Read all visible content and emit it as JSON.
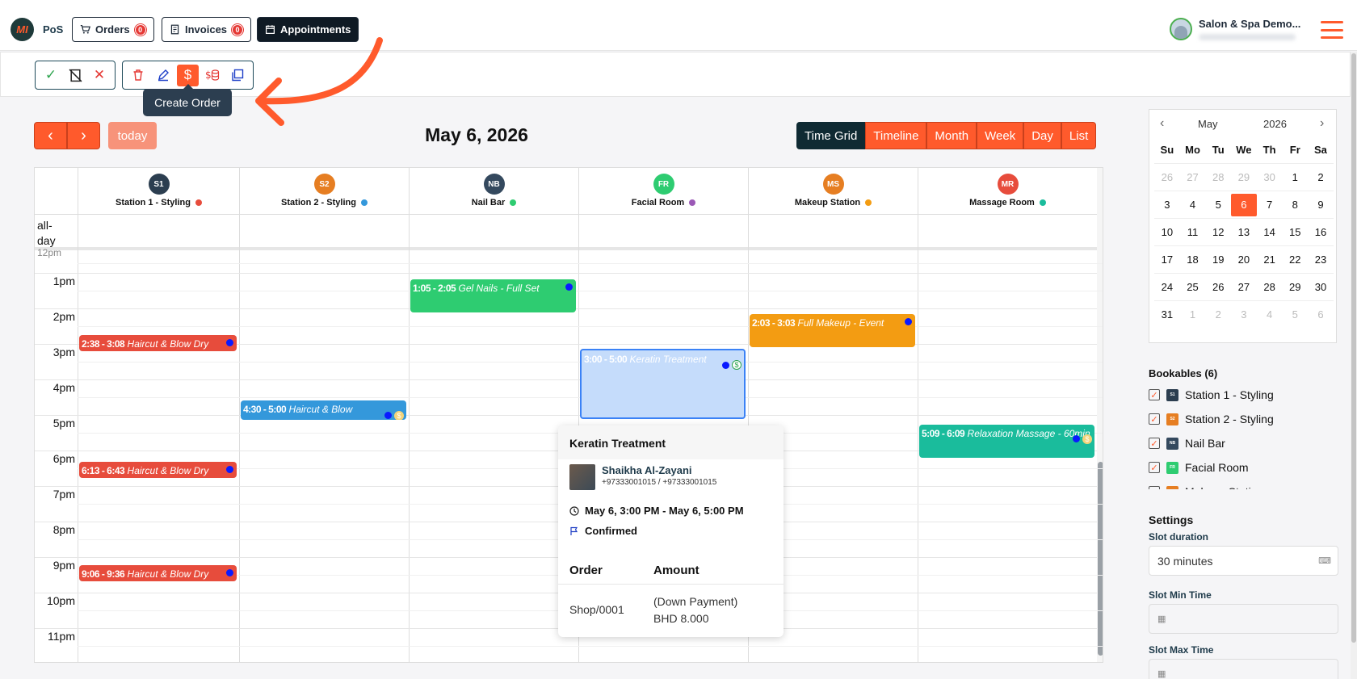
{
  "header": {
    "logo_text": "MI",
    "app_name": "PoS",
    "orders_label": "Orders",
    "orders_count": "0",
    "invoices_label": "Invoices",
    "invoices_count": "0",
    "appointments_label": "Appointments",
    "user_name": "Salon & Spa Demo..."
  },
  "toolbar": {
    "tooltip": "Create Order",
    "highlight_color": "#ff5a2c"
  },
  "calendar": {
    "today_label": "today",
    "title": "May 6, 2026",
    "views": [
      "Time Grid",
      "Timeline",
      "Month",
      "Week",
      "Day",
      "List"
    ],
    "allday_label": "all-day",
    "partial_label": "12pm",
    "hours": [
      "1pm",
      "2pm",
      "3pm",
      "4pm",
      "5pm",
      "6pm",
      "7pm",
      "8pm",
      "9pm",
      "10pm",
      "11pm"
    ],
    "resources": [
      {
        "code": "S1",
        "name": "Station 1 - Styling",
        "badge_color": "#2c3e50",
        "dot_color": "#e74c3c"
      },
      {
        "code": "S2",
        "name": "Station 2 - Styling",
        "badge_color": "#e67e22",
        "dot_color": "#3498db"
      },
      {
        "code": "NB",
        "name": "Nail Bar",
        "badge_color": "#34495e",
        "dot_color": "#2ecc71"
      },
      {
        "code": "FR",
        "name": "Facial Room",
        "badge_color": "#2ecc71",
        "dot_color": "#9b59b6"
      },
      {
        "code": "MS",
        "name": "Makeup Station",
        "badge_color": "#e67e22",
        "dot_color": "#f39c12"
      },
      {
        "code": "MR",
        "name": "Massage Room",
        "badge_color": "#e74c3c",
        "dot_color": "#1abc9c"
      }
    ],
    "events": [
      {
        "time": "1:05 - 2:05",
        "title": "Gel Nails - Full Set",
        "color": "#2ecc71"
      },
      {
        "time": "2:03 - 3:03",
        "title": "Full Makeup - Event",
        "color": "#f39c12"
      },
      {
        "time": "2:38 - 3:08",
        "title": "Haircut & Blow Dry",
        "color": "#e74c3c"
      },
      {
        "time": "3:00 - 5:00",
        "title": "Keratin Treatment",
        "color": "#c5dcfb"
      },
      {
        "time": "4:30 - 5:00",
        "title": "Haircut & Blow",
        "color": "#3498db"
      },
      {
        "time": "5:09 - 6:09",
        "title": "Relaxation Massage - 60min",
        "color": "#1abc9c"
      },
      {
        "time": "6:13 - 6:43",
        "title": "Haircut & Blow Dry",
        "color": "#e74c3c"
      },
      {
        "time": "9:06 - 9:36",
        "title": "Haircut & Blow Dry",
        "color": "#e74c3c"
      }
    ]
  },
  "popover": {
    "title": "Keratin Treatment",
    "client_name": "Shaikha Al-Zayani",
    "client_phone": "+97333001015 / +97333001015",
    "datetime": "May 6, 3:00 PM - May 6, 5:00 PM",
    "status": "Confirmed",
    "col_order": "Order",
    "col_amount": "Amount",
    "order_no": "Shop/0001",
    "amount_type": "(Down Payment)",
    "amount": "BHD 8.000"
  },
  "minical": {
    "month": "May",
    "year": "2026",
    "dow": [
      "Su",
      "Mo",
      "Tu",
      "We",
      "Th",
      "Fr",
      "Sa"
    ],
    "weeks": [
      [
        "26",
        "27",
        "28",
        "29",
        "30",
        "1",
        "2"
      ],
      [
        "3",
        "4",
        "5",
        "6",
        "7",
        "8",
        "9"
      ],
      [
        "10",
        "11",
        "12",
        "13",
        "14",
        "15",
        "16"
      ],
      [
        "17",
        "18",
        "19",
        "20",
        "21",
        "22",
        "23"
      ],
      [
        "24",
        "25",
        "26",
        "27",
        "28",
        "29",
        "30"
      ],
      [
        "31",
        "1",
        "2",
        "3",
        "4",
        "5",
        "6"
      ]
    ],
    "today": "6"
  },
  "bookables": {
    "title": "Bookables (6)",
    "items": [
      "Station 1 - Styling",
      "Station 2 - Styling",
      "Nail Bar",
      "Facial Room",
      "Makeup Station"
    ]
  },
  "settings": {
    "title": "Settings",
    "slot_duration_label": "Slot duration",
    "slot_duration_value": "30 minutes",
    "slot_min_label": "Slot Min Time",
    "slot_max_label": "Slot Max Time"
  }
}
